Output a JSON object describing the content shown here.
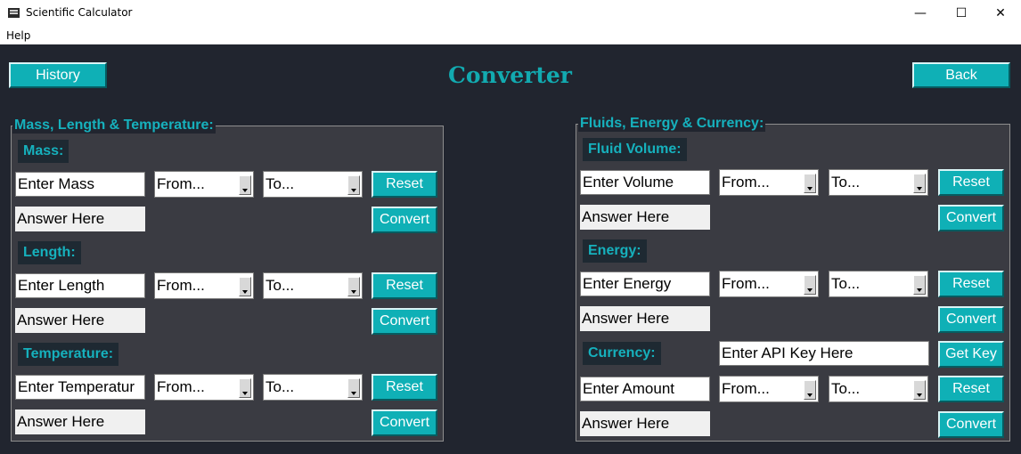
{
  "window": {
    "title": "Scientific Calculator",
    "minimize_glyph": "—",
    "maximize_glyph": "☐",
    "close_glyph": "✕"
  },
  "menu": {
    "help": "Help"
  },
  "header": {
    "history_label": "History",
    "page_title": "Converter",
    "back_label": "Back"
  },
  "left_panel": {
    "title": "Mass, Length & Temperature:",
    "mass": {
      "label": "Mass:",
      "input": "Enter Mass",
      "from": "From...",
      "to": "To...",
      "reset": "Reset",
      "answer": "Answer Here",
      "convert": "Convert"
    },
    "length": {
      "label": "Length:",
      "input": "Enter Length",
      "from": "From...",
      "to": "To...",
      "reset": "Reset",
      "answer": "Answer Here",
      "convert": "Convert"
    },
    "temperature": {
      "label": "Temperature:",
      "input": "Enter Temperatur",
      "from": "From...",
      "to": "To...",
      "reset": "Reset",
      "answer": "Answer Here",
      "convert": "Convert"
    }
  },
  "right_panel": {
    "title": "Fluids, Energy & Currency:",
    "fluid_volume": {
      "label": "Fluid Volume:",
      "input": "Enter Volume",
      "from": "From...",
      "to": "To...",
      "reset": "Reset",
      "answer": "Answer Here",
      "convert": "Convert"
    },
    "energy": {
      "label": "Energy:",
      "input": "Enter Energy",
      "from": "From...",
      "to": "To...",
      "reset": "Reset",
      "answer": "Answer Here",
      "convert": "Convert"
    },
    "currency": {
      "label": "Currency:",
      "api_key": "Enter API Key Here",
      "get_key": "Get Key",
      "input": "Enter Amount",
      "from": "From...",
      "to": "To...",
      "reset": "Reset",
      "answer": "Answer Here",
      "convert": "Convert"
    }
  },
  "colors": {
    "background": "#21252f",
    "panel": "#3a3b42",
    "accent": "#0fb0b6",
    "label_text": "#16b1bd"
  }
}
